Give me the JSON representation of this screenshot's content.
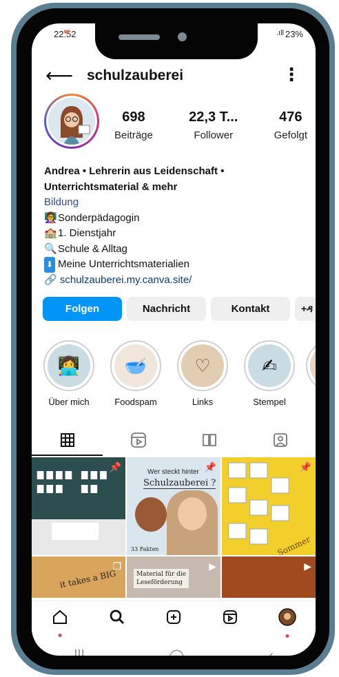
{
  "status": {
    "time": "22:52",
    "battery": "23%",
    "signal": ".ıll"
  },
  "header": {
    "username": "schulzauberei",
    "back_icon": "arrow-left-icon",
    "more_icon": "more-vertical-icon"
  },
  "profile": {
    "stats": [
      {
        "value": "698",
        "label": "Beiträge"
      },
      {
        "value": "22,3 T...",
        "label": "Follower"
      },
      {
        "value": "476",
        "label": "Gefolgt"
      }
    ],
    "name_line1": "Andrea • Lehrerin aus Leidenschaft •",
    "name_line2": "Unterrichtsmaterial & mehr",
    "category": "Bildung",
    "bio_lines": [
      {
        "emoji": "👩‍🏫",
        "text": "Sonderpädagogin"
      },
      {
        "emoji": "🏫",
        "text": "1. Dienstjahr"
      },
      {
        "emoji": "🔍",
        "text": "Schule & Alltag"
      },
      {
        "emoji": "⬇",
        "text": "Meine Unterrichtsmaterialien"
      }
    ],
    "link": "schulzauberei.my.canva.site/",
    "avatar_text": "Schulzauberei"
  },
  "actions": {
    "follow": "Folgen",
    "message": "Nachricht",
    "contact": "Kontakt",
    "add_user": "+ዳ"
  },
  "stories": [
    {
      "label": "Über mich",
      "icon": "👩‍💻"
    },
    {
      "label": "Foodspam",
      "icon": "🥣"
    },
    {
      "label": "Links",
      "icon": "♡"
    },
    {
      "label": "Stempel",
      "icon": "✍"
    }
  ],
  "tabs": [
    "grid-icon",
    "reels-icon",
    "guides-icon",
    "tagged-icon"
  ],
  "posts": {
    "p2_title": "Wer steckt hinter",
    "p2_name": "Schulzauberei ?",
    "p2_count": "33 Fakten",
    "p3_season": "Sommer",
    "p4_text": "it takes a BIG",
    "p5_text1": "Material für die",
    "p5_text2": "Leseförderung"
  },
  "colors": {
    "accent": "#0095f6",
    "frame": "#5b7f92"
  }
}
